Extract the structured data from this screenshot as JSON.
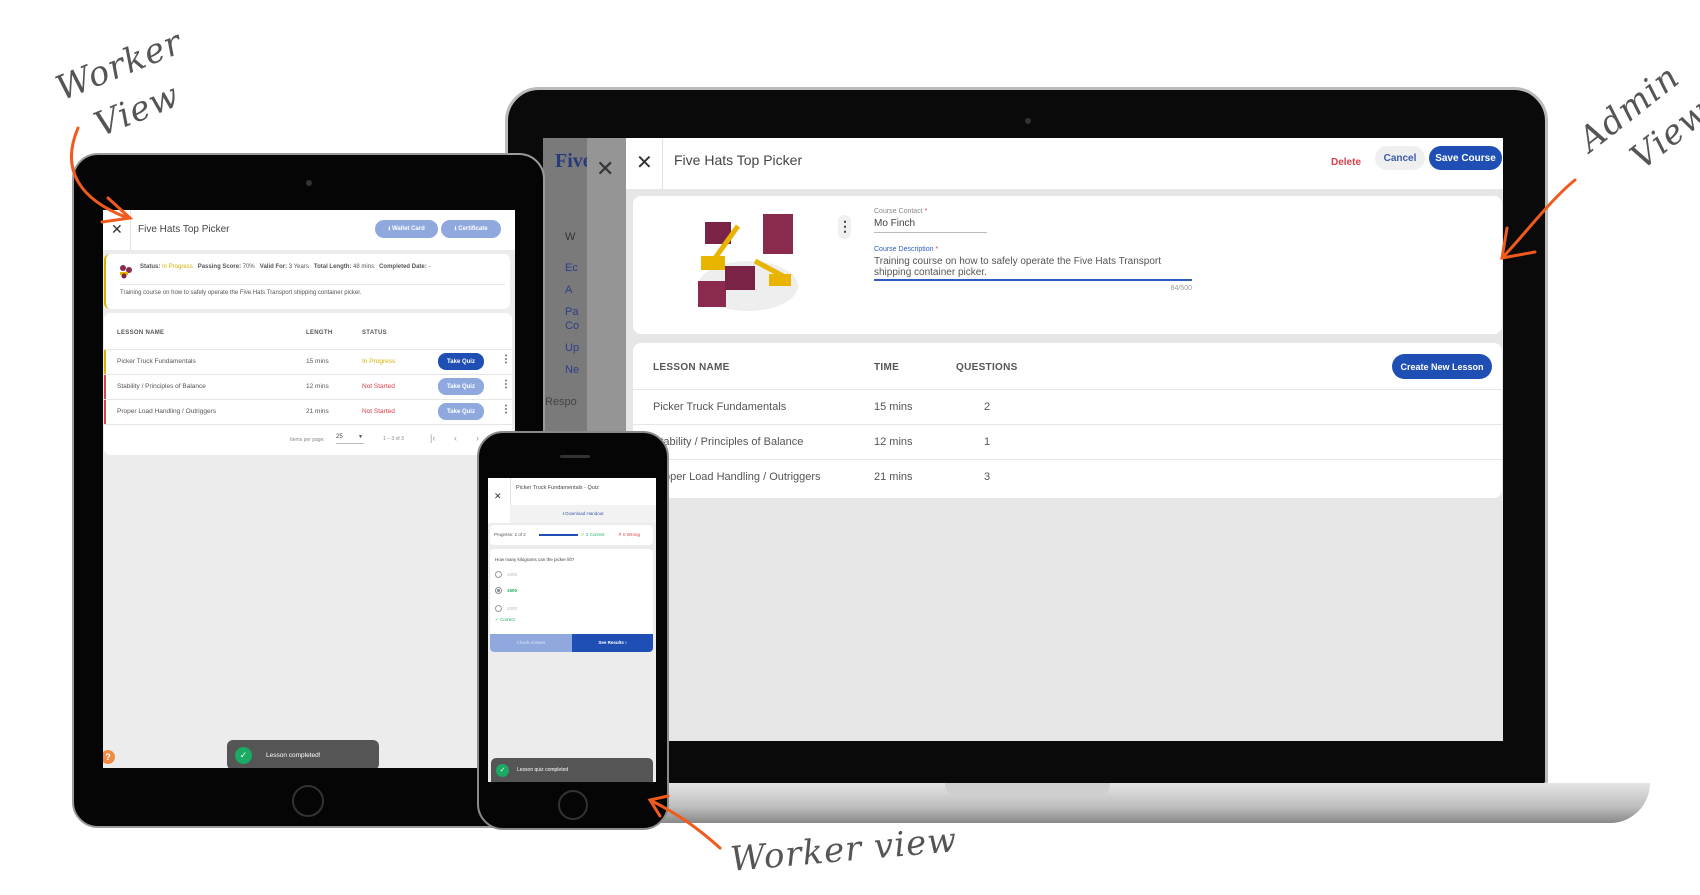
{
  "annotations": {
    "worker_top": [
      "Worker",
      "View"
    ],
    "admin": [
      "Admin",
      "View"
    ],
    "worker_bottom": "Worker view",
    "arrow_color": "#f05a1e"
  },
  "colors": {
    "primary": "#1f4fb5",
    "primary_light": "#8fa8de",
    "yellow": "#d4b200",
    "red": "#d9414a",
    "green": "#1aaa62"
  },
  "laptop": {
    "bg_app": {
      "logo": "Five",
      "letters": [
        "W",
        "Ec",
        "A",
        "Pa",
        "Co",
        "Up",
        "Ne"
      ],
      "footer": "Respo"
    },
    "title": "Five Hats Top Picker",
    "delete": "Delete",
    "cancel": "Cancel",
    "save": "Save Course",
    "contact_label": "Course Contact",
    "contact_value": "Mo Finch",
    "desc_label": "Course Description",
    "desc_value": "Training course on how to safely operate the Five Hats Transport shipping container picker.",
    "required": "*",
    "counter": "84/500",
    "table": {
      "headers": [
        "LESSON NAME",
        "TIME",
        "QUESTIONS"
      ],
      "create": "Create New Lesson",
      "rows": [
        [
          "Picker Truck Fundamentals",
          "15 mins",
          "2"
        ],
        [
          "Stability / Principles of Balance",
          "12 mins",
          "1"
        ],
        [
          "Proper Load Handling / Outriggers",
          "21 mins",
          "3"
        ]
      ]
    }
  },
  "tablet": {
    "title": "Five Hats Top Picker",
    "wallet": "Wallet Card",
    "certificate": "Certificate",
    "info": [
      {
        "k": "Status:",
        "v": "In Progress"
      },
      {
        "k": "Passing Score:",
        "v": "70%"
      },
      {
        "k": "Valid For:",
        "v": "3 Years"
      },
      {
        "k": "Total Length:",
        "v": "48 mins"
      },
      {
        "k": "Completed Date:",
        "v": "-"
      }
    ],
    "description": "Training course on how to safely operate the Five Hats Transport shipping container picker.",
    "headers": [
      "LESSON NAME",
      "LENGTH",
      "STATUS"
    ],
    "rows": [
      {
        "name": "Picker Truck Fundamentals",
        "length": "15 mins",
        "status": "In Progress",
        "action": "Take Quiz"
      },
      {
        "name": "Stability / Principles of Balance",
        "length": "12 mins",
        "status": "Not Started",
        "action": "Take Quiz"
      },
      {
        "name": "Proper Load Handling / Outriggers",
        "length": "21 mins",
        "status": "Not Started",
        "action": "Take Quiz"
      }
    ],
    "pager": {
      "label": "Items per page:",
      "size": "25",
      "range": "1 – 3 of 3"
    },
    "toast": "Lesson completed!",
    "help": "?"
  },
  "phone": {
    "title": "Picker Truck Fundamentals - Quiz",
    "download": "Download Handout",
    "progress": "Progress: 2 of 2",
    "progress_fraction": 1.0,
    "correct": "✓ 2 Correct",
    "wrong": "✕ 0 Wrong",
    "question": "How many kilograms can the picker lift?",
    "options": [
      "1000",
      "1500",
      "2000"
    ],
    "selected": "1500",
    "feedback": "✓ Correct",
    "check": "Check Answer",
    "results": "See Results",
    "toast": "Lesson quiz completed"
  }
}
